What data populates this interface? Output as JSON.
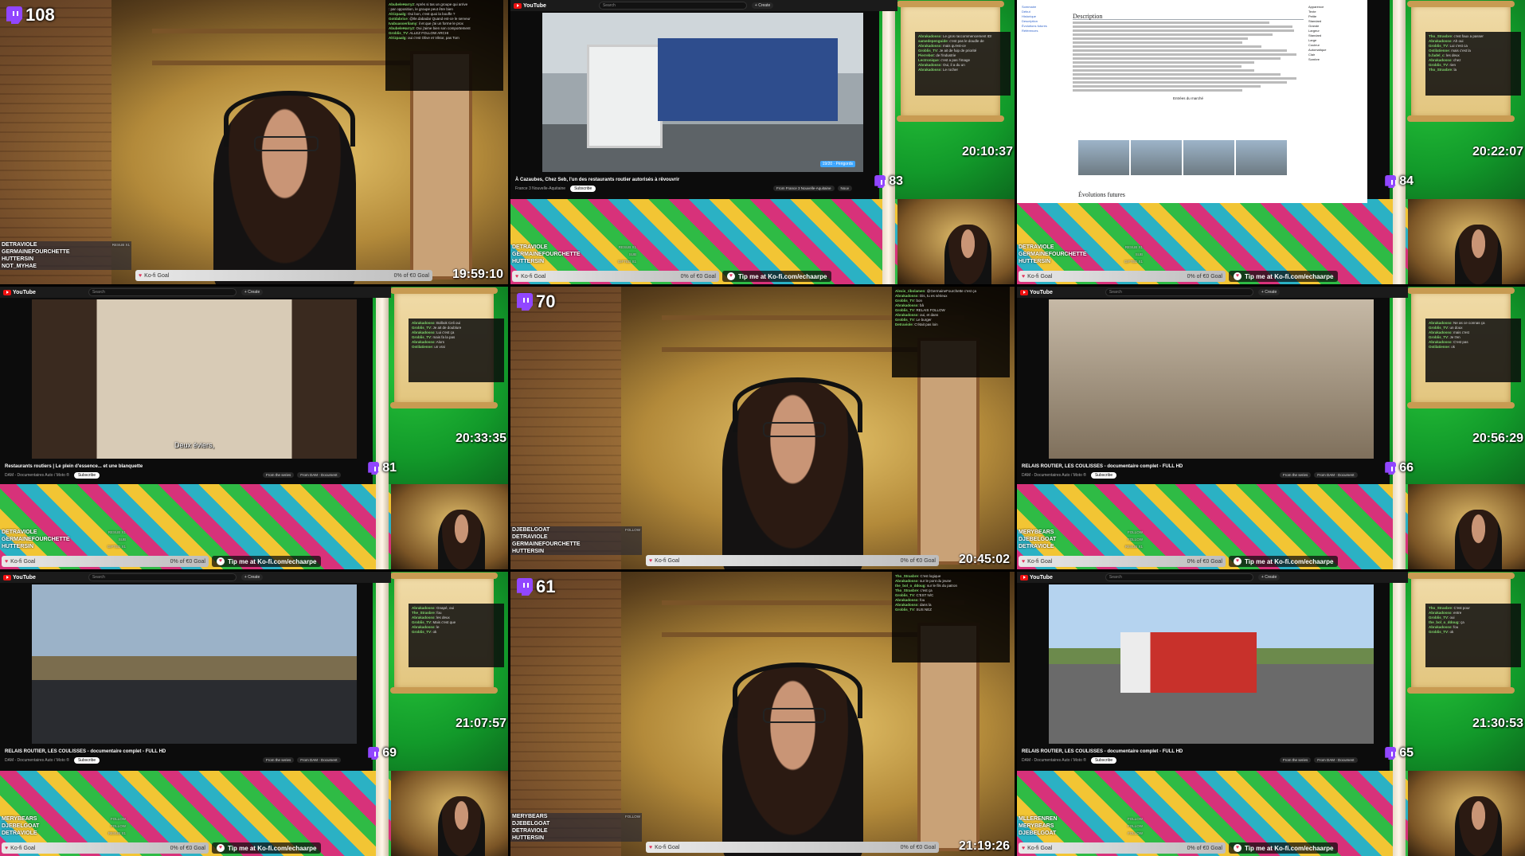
{
  "tiles": [
    {
      "id": "t1",
      "kind": "cam",
      "viewers": "108",
      "clock": "19:59:10",
      "goal": {
        "label": "Ko-fi Goal",
        "progress": "0% of €0 Goal"
      },
      "events": [
        {
          "name": "DETRAVIOLE",
          "tag": "RESUB X1"
        },
        {
          "name": "GERMAINEFOURCHETTE",
          "tag": ""
        },
        {
          "name": "HUTTERSIN",
          "tag": ""
        },
        {
          "name": "NOT_MYHAE",
          "tag": ""
        }
      ],
      "chat": [
        {
          "u": "AbubeleHarry2",
          "t": "Après si tas un groupe qui arrive"
        },
        {
          "u": "",
          "t": "par opposition, le groupe peut être bien"
        },
        {
          "u": "Alrizpaalg",
          "t": "Oui bon, c'est quoi la bouffe ?"
        },
        {
          "u": "Gotdabrice",
          "t": "@Ile.dabadar Quand est-ce le serveur"
        },
        {
          "u": "Ivabuasoerilamy",
          "t": "il et que j'ai un forme le prox"
        },
        {
          "u": "AbubeleHarry2",
          "t": "Oui j'aime bien son comportement"
        },
        {
          "u": "Groblis_TV",
          "t": "ALLEZ FOLLOW ARCHI"
        },
        {
          "u": "Alrizpaalg",
          "t": "oui c'est Olive et Viktor, pas Tom"
        }
      ]
    },
    {
      "id": "t2",
      "kind": "browser",
      "video": "truck1",
      "viewers": "83",
      "clock": "20:10:37",
      "title": "À Cazaubes, Chez Seb, l'un des restaurants routier autorisés à rêvouvrir",
      "channel": "France 3 Nouvelle-Aquitaine",
      "subscribe": "Subscribe",
      "chips": [
        "From France 3 Nouvelle-Aquitaine",
        "Nouv"
      ],
      "speedChip": "19/20 · Périgords",
      "goal": {
        "label": "Ko-fi Goal",
        "progress": "0% of €0 Goal"
      },
      "tip": "Tip me at Ko-fi.com/echaarpe",
      "events": [
        {
          "name": "DETRAVIOLE",
          "tag": "RESUB X1"
        },
        {
          "name": "GERMAINEFOURCHETTE",
          "tag": "SUB"
        },
        {
          "name": "HUTTERSIN",
          "tag": "GIFTED X1"
        }
      ],
      "chat": [
        {
          "u": "Abrakadosso",
          "t": "Le gros raccommencement ID!"
        },
        {
          "u": "samedepenguide",
          "t": "c'est pas le doudle de"
        },
        {
          "u": "Abrakadosso",
          "t": "mais qu'est-ce"
        },
        {
          "u": "Groblis_TV",
          "t": "Je ait de fuip de priorité"
        },
        {
          "u": "Pierrebot",
          "t": "de l'industrie"
        },
        {
          "u": "Lectronique",
          "t": "c'est a pas l'image"
        },
        {
          "u": "Abrakadosso",
          "t": "Oui, il a du un"
        },
        {
          "u": "Abrakadosso",
          "t": "Le rocher"
        }
      ]
    },
    {
      "id": "t3",
      "kind": "wiki",
      "viewers": "84",
      "clock": "20:22:07",
      "wikiTitle": "Description",
      "wikiSide": [
        "Sommaire",
        "Début",
        "Historique",
        "Description",
        "Évolutions futures",
        "Références"
      ],
      "wikiRight": [
        "Apparence",
        "Texte",
        "Petite",
        "Standard",
        "Grande",
        "Largeur",
        "Standard",
        "Large",
        "Couleur",
        "Automatique",
        "Clair",
        "Sombre"
      ],
      "wikiGallery": "Entrées du marché",
      "wikiSection": "Évolutions futures",
      "goal": {
        "label": "Ko-fi Goal",
        "progress": "0% of €0 Goal"
      },
      "tip": "Tip me at Ko-fi.com/echaarpe",
      "events": [
        {
          "name": "DETRAVIOLE",
          "tag": "RESUB X1"
        },
        {
          "name": "GERMAINEFOURCHETTE",
          "tag": "SUB"
        },
        {
          "name": "HUTTERSIN",
          "tag": "GIFTED X1"
        }
      ],
      "chat": [
        {
          "u": "Tho_Strasbre",
          "t": "c'est faux a passer"
        },
        {
          "u": "Abrakadosso",
          "t": "Ah oui"
        },
        {
          "u": "Groblis_TV",
          "t": "Lui c'est ca"
        },
        {
          "u": "Ostilatienne",
          "t": "mais c'est la"
        },
        {
          "u": "b.fadel_c",
          "t": "les deux"
        },
        {
          "u": "Abrakadosso",
          "t": "chez"
        },
        {
          "u": "Groblis_TV",
          "t": "rien"
        },
        {
          "u": "Tho_Strasbre",
          "t": "la"
        }
      ]
    },
    {
      "id": "t4",
      "kind": "browser",
      "video": "bath",
      "viewers": "81",
      "clock": "20:33:35",
      "title": "Restaurants routiers | Le plein d'essence... et une blanquette",
      "channel": "DAM - Documentaires Auto / Moto ®",
      "subscribe": "Subscribe",
      "chips": [
        "From the series",
        "From DAM - Document"
      ],
      "caption": "Deux éviers,",
      "goal": {
        "label": "Ko-fi Goal",
        "progress": "0% of €0 Goal"
      },
      "tip": "Tip me at Ko-fi.com/echaarpe",
      "events": [
        {
          "name": "DETRAVIOLE",
          "tag": "RESUB X1"
        },
        {
          "name": "GERMAINEFOURCHETTE",
          "tag": "SUB"
        },
        {
          "name": "HUTTERSIN",
          "tag": "GIFTED X1"
        }
      ],
      "chat": [
        {
          "u": "Abrakadosso",
          "t": "Bolbok Celi oui"
        },
        {
          "u": "Groblis_TV",
          "t": "Je ait de doublure"
        },
        {
          "u": "Abrakadosso",
          "t": "Lui c'est ça"
        },
        {
          "u": "Groblis_TV",
          "t": "mais fa la pas"
        },
        {
          "u": "Abrakadosso",
          "t": "Alors"
        },
        {
          "u": "Ostilatienne",
          "t": "un vrai"
        }
      ]
    },
    {
      "id": "t5",
      "kind": "cam",
      "viewers": "70",
      "clock": "20:45:02",
      "goal": {
        "label": "Ko-fi Goal",
        "progress": "0% of €0 Goal"
      },
      "events": [
        {
          "name": "DJEBELGOAT",
          "tag": "FOLLOW"
        },
        {
          "name": "DETRAVIOLE",
          "tag": ""
        },
        {
          "name": "GERMAINEFOURCHETTE",
          "tag": ""
        },
        {
          "name": "HUTTERSIN",
          "tag": ""
        }
      ],
      "chat": [
        {
          "u": "Alexis_ribolamen",
          "t": "@GermaineFourchette c'est ça"
        },
        {
          "u": "Abrakadosso",
          "t": "Dis, tu es sérieux"
        },
        {
          "u": "Groblis_TV",
          "t": "bon"
        },
        {
          "u": "Abrakadosso",
          "t": "bâ"
        },
        {
          "u": "Groblis_TV",
          "t": "RELAIS FOLLOW"
        },
        {
          "u": "Abrakadosso",
          "t": "oui, et dans"
        },
        {
          "u": "Groblis_TV",
          "t": "Le burger"
        },
        {
          "u": "Detraviole",
          "t": "C'était pas loin"
        }
      ]
    },
    {
      "id": "t6",
      "kind": "browser",
      "video": "crowd",
      "viewers": "66",
      "clock": "20:56:29",
      "title": "RELAIS ROUTIER, LES COULISSES - documentaire complet - FULL HD",
      "channel": "DAM - Documentaires Auto / Moto ®",
      "subscribe": "Subscribe",
      "chips": [
        "From the series",
        "From DAM - Document"
      ],
      "goal": {
        "label": "Ko-fi Goal",
        "progress": "0% of €0 Goal"
      },
      "tip": "Tip me at Ko-fi.com/echaarpe",
      "events": [
        {
          "name": "MERYBEARS",
          "tag": "FOLLOW"
        },
        {
          "name": "DJEBELGOAT",
          "tag": "FOLLOW"
        },
        {
          "name": "DETRAVIOLE",
          "tag": "RESUB X1"
        }
      ],
      "chat": [
        {
          "u": "Abrakadosso",
          "t": "Ne as ce connas ça"
        },
        {
          "u": "Groblis_TV",
          "t": "un doux"
        },
        {
          "u": "Abrakadosso",
          "t": "mais c'est"
        },
        {
          "u": "Groblis_TV",
          "t": "Je t'en"
        },
        {
          "u": "Abrakadosso",
          "t": "C'est pas"
        },
        {
          "u": "Ostilatienne",
          "t": "ok"
        }
      ]
    },
    {
      "id": "t7",
      "kind": "browser",
      "video": "car",
      "viewers": "69",
      "clock": "21:07:57",
      "title": "RELAIS ROUTIER, LES COULISSES - documentaire complet - FULL HD",
      "channel": "DAM - Documentaires Auto / Moto ®",
      "subscribe": "Subscribe",
      "chips": [
        "From the series",
        "From DAM - Document"
      ],
      "goal": {
        "label": "Ko-fi Goal",
        "progress": "0% of €0 Goal"
      },
      "tip": "Tip me at Ko-fi.com/echaarpe",
      "events": [
        {
          "name": "MERYBEARS",
          "tag": "FOLLOW"
        },
        {
          "name": "DJEBELGOAT",
          "tag": "FOLLOW"
        },
        {
          "name": "DETRAVIOLE",
          "tag": "RESUB X1"
        }
      ],
      "chat": [
        {
          "u": "Abrakadosso",
          "t": "Gnapé, oui"
        },
        {
          "u": "The_Strasbre",
          "t": "fou"
        },
        {
          "u": "Abrakadosso",
          "t": "les deux"
        },
        {
          "u": "Groblis_TV",
          "t": "Mais c'est que"
        },
        {
          "u": "Abrakadosso",
          "t": "le"
        },
        {
          "u": "Groblis_TV",
          "t": "ok"
        }
      ]
    },
    {
      "id": "t8",
      "kind": "cam",
      "viewers": "61",
      "clock": "21:19:26",
      "goal": {
        "label": "Ko-fi Goal",
        "progress": "0% of €0 Goal"
      },
      "events": [
        {
          "name": "MERYBEARS",
          "tag": "FOLLOW"
        },
        {
          "name": "DJEBELGOAT",
          "tag": ""
        },
        {
          "name": "DETRAVIOLE",
          "tag": ""
        },
        {
          "name": "HUTTERSIN",
          "tag": ""
        }
      ],
      "chat": [
        {
          "u": "Tho_Strasbre",
          "t": "C'est logique"
        },
        {
          "u": "Abrakadosso",
          "t": "sur le pont du jeune"
        },
        {
          "u": "the_bol_o_ddoug",
          "t": "sur le fils du patron"
        },
        {
          "u": "Tho_Strasbre",
          "t": "c'est ça"
        },
        {
          "u": "Groblis_TV",
          "t": "C'EST N/C"
        },
        {
          "u": "Abrakadosso",
          "t": "fou"
        },
        {
          "u": "Abrakadosso",
          "t": "dans la"
        },
        {
          "u": "Groblis_TV",
          "t": "SUS NEZ"
        }
      ]
    },
    {
      "id": "t9",
      "kind": "browser",
      "video": "road",
      "viewers": "65",
      "clock": "21:30:53",
      "title": "RELAIS ROUTIER, LES COULISSES - documentaire complet - FULL HD",
      "channel": "DAM - Documentaires Auto / Moto ®",
      "subscribe": "Subscribe",
      "chips": [
        "From the series",
        "From DAM - Document"
      ],
      "goal": {
        "label": "Ko-fi Goal",
        "progress": "0% of €0 Goal"
      },
      "tip": "Tip me at Ko-fi.com/echaarpe",
      "events": [
        {
          "name": "MLLERENREN",
          "tag": "FOLLOW"
        },
        {
          "name": "MERYBEARS",
          "tag": "FOLLOW"
        },
        {
          "name": "DJEBELGOAT",
          "tag": "FOLLOW"
        }
      ],
      "chat": [
        {
          "u": "Tho_Strasbre",
          "t": "C'est pour"
        },
        {
          "u": "Abrakadosso",
          "t": "entre"
        },
        {
          "u": "Groblis_TV",
          "t": "oui"
        },
        {
          "u": "the_bol_o_ddoug",
          "t": "ça"
        },
        {
          "u": "Abrakadosso",
          "t": "fou"
        },
        {
          "u": "Groblis_TV",
          "t": "ok"
        }
      ]
    }
  ],
  "ui": {
    "search": "Search",
    "create": "+ Create",
    "brand": "YouTube"
  },
  "colors": {
    "twitch": "#9146ff",
    "youtube": "#e11",
    "kofi": "#e0335a"
  }
}
